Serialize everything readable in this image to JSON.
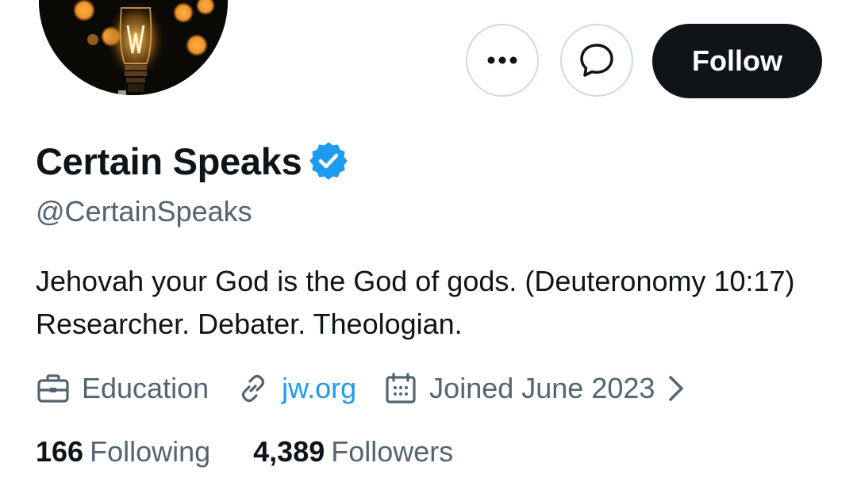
{
  "profile": {
    "display_name": "Certain Speaks",
    "verified": true,
    "handle": "@CertainSpeaks",
    "bio": "Jehovah your God is the God of gods. (Deuteronomy 10:17) Researcher. Debater. Theologian."
  },
  "actions": {
    "more_icon": "more-dots-icon",
    "message_icon": "message-bubble-icon",
    "follow_label": "Follow"
  },
  "meta": {
    "category": "Education",
    "category_icon": "briefcase-icon",
    "website": "jw.org",
    "website_icon": "link-icon",
    "joined": "Joined June 2023",
    "joined_icon": "calendar-icon"
  },
  "stats": {
    "following_count": "166",
    "following_label": "Following",
    "followers_count": "4,389",
    "followers_label": "Followers"
  },
  "colors": {
    "text_primary": "#0f1419",
    "text_secondary": "#536471",
    "link": "#1d9bf0",
    "verified": "#1d9bf0",
    "follow_button_bg": "#0f1419",
    "border": "#cfd9de"
  }
}
